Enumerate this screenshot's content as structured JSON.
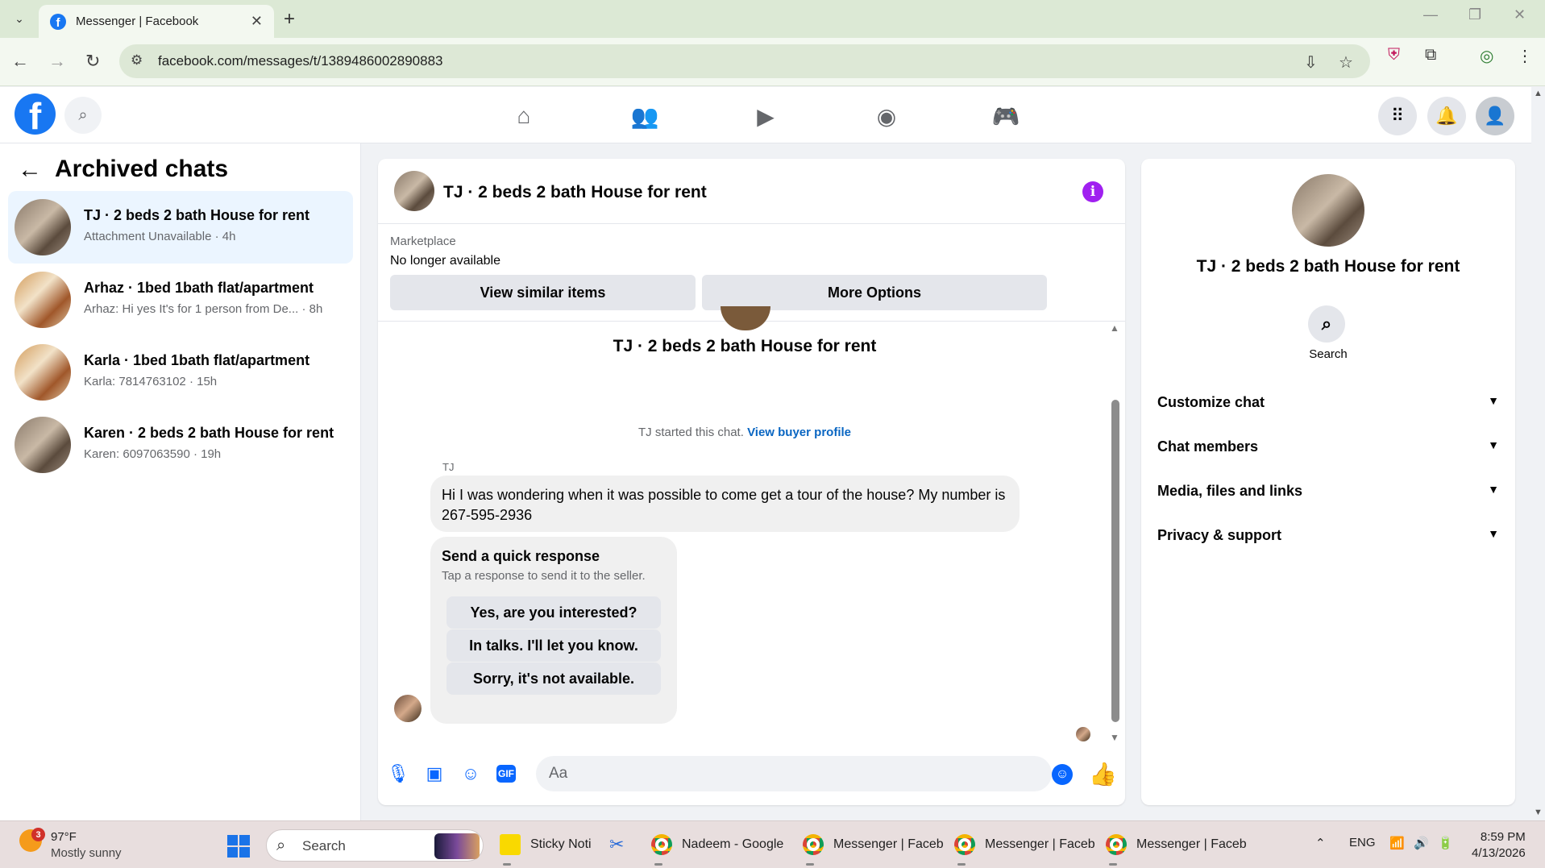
{
  "browser": {
    "tab_title": "Messenger | Facebook",
    "url": "facebook.com/messages/t/1389486002890883"
  },
  "sidebar": {
    "title": "Archived chats",
    "chats": [
      {
        "name": "TJ · 2 beds 2 bath House for rent",
        "snippet": "Attachment Unavailable · 4h"
      },
      {
        "name": "Arhaz · 1bed 1bath flat/apartment",
        "snippet": "Arhaz: Hi yes It's for 1 person from De... · 8h"
      },
      {
        "name": "Karla · 1bed 1bath flat/apartment",
        "snippet": "Karla: 7814763102 · 15h"
      },
      {
        "name": "Karen · 2 beds 2 bath House for rent",
        "snippet": "Karen: 6097063590 · 19h"
      }
    ]
  },
  "conversation": {
    "title": "TJ · 2 beds 2 bath House for rent",
    "marketplace_label": "Marketplace",
    "listing_status": "No longer available",
    "view_similar_label": "View similar items",
    "more_options_label": "More Options",
    "thread_title": "TJ · 2 beds 2 bath House for rent",
    "started_text": "TJ started this chat.",
    "buyer_profile_link": "View buyer profile",
    "sender": "TJ",
    "message": "Hi I was wondering when it was possible to come get a tour of the house? My number is 267-595-2936",
    "quick_response": {
      "heading": "Send a quick response",
      "subtext": "Tap a response to send it to the seller.",
      "options": [
        "Yes, are you interested?",
        "In talks. I'll let you know.",
        "Sorry, it's not available."
      ]
    },
    "input_placeholder": "Aa"
  },
  "details": {
    "name": "TJ · 2 beds 2 bath House for rent",
    "search_label": "Search",
    "sections": [
      "Customize chat",
      "Chat members",
      "Media, files and links",
      "Privacy & support"
    ]
  },
  "taskbar": {
    "weather_badge": "3",
    "temperature": "97°F",
    "condition": "Mostly sunny",
    "search_label": "Search",
    "apps": [
      "Sticky Noti",
      "Nadeem - Google",
      "Messenger | Faceb",
      "Messenger | Faceb",
      "Messenger | Faceb"
    ],
    "language": "ENG",
    "time": "8:59 PM",
    "date": "4/13/2026"
  },
  "colors": {
    "facebook_blue": "#1877f2",
    "messenger_blue": "#0866ff",
    "info_purple": "#a020f0",
    "active_chat_bg": "#ebf5ff"
  }
}
